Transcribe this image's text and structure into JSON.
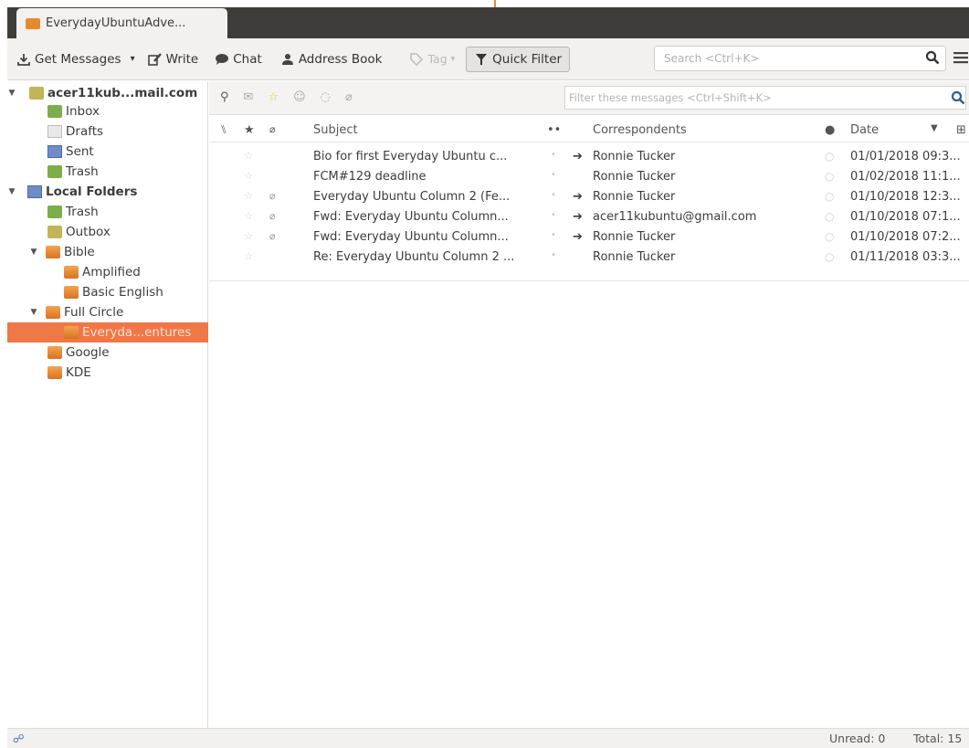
{
  "window": {
    "tab_title": "EverydayUbuntuAdve..."
  },
  "toolbar": {
    "get_messages": "Get Messages",
    "write": "Write",
    "chat": "Chat",
    "address_book": "Address Book",
    "tag": "Tag",
    "quick_filter": "Quick Filter",
    "search_placeholder": "Search <Ctrl+K>"
  },
  "folders": [
    {
      "label": "acer11kub...mail.com",
      "icon": "account-icon"
    },
    {
      "label": "Inbox",
      "icon": "inbox-icon"
    },
    {
      "label": "Drafts",
      "icon": "drafts-icon"
    },
    {
      "label": "Sent",
      "icon": "sent-icon"
    },
    {
      "label": "Trash",
      "icon": "trash-icon"
    },
    {
      "label": "Local Folders",
      "icon": "local-folders-icon"
    },
    {
      "label": "Trash",
      "icon": "trash-icon"
    },
    {
      "label": "Outbox",
      "icon": "outbox-icon"
    },
    {
      "label": "Bible",
      "icon": "folder-icon"
    },
    {
      "label": "Amplified",
      "icon": "folder-icon"
    },
    {
      "label": "Basic English",
      "icon": "folder-icon"
    },
    {
      "label": "Full Circle",
      "icon": "folder-icon"
    },
    {
      "label": "Everyda...entures",
      "icon": "folder-icon",
      "selected": true
    },
    {
      "label": "Google",
      "icon": "folder-icon"
    },
    {
      "label": "KDE",
      "icon": "folder-icon"
    }
  ],
  "quickfilter": {
    "filter_placeholder": "Filter these messages <Ctrl+Shift+K>"
  },
  "columns": {
    "subject": "Subject",
    "correspondents": "Correspondents",
    "date": "Date"
  },
  "messages": [
    {
      "subject": "Bio for first Everyday Ubuntu c...",
      "correspondent": "Ronnie Tucker",
      "replied": true,
      "attachment": false,
      "date": "01/01/2018 09:3..."
    },
    {
      "subject": "FCM#129 deadline",
      "correspondent": "Ronnie Tucker",
      "replied": false,
      "attachment": false,
      "date": "01/02/2018 11:1..."
    },
    {
      "subject": "Everyday Ubuntu Column 2 (Fe...",
      "correspondent": "Ronnie Tucker",
      "replied": true,
      "attachment": true,
      "date": "01/10/2018 12:3..."
    },
    {
      "subject": "Fwd: Everyday Ubuntu Column...",
      "correspondent": "acer11kubuntu@gmail.com",
      "replied": true,
      "attachment": true,
      "date": "01/10/2018 07:1..."
    },
    {
      "subject": "Fwd: Everyday Ubuntu Column...",
      "correspondent": "Ronnie Tucker",
      "replied": true,
      "attachment": true,
      "date": "01/10/2018 07:2..."
    },
    {
      "subject": "Re: Everyday Ubuntu Column 2 ...",
      "correspondent": "Ronnie Tucker",
      "replied": false,
      "attachment": false,
      "date": "01/11/2018 03:3..."
    }
  ],
  "status": {
    "unread": "Unread: 0",
    "total": "Total: 15"
  },
  "colors": {
    "selection": "#f07746",
    "folder": "#e58b2f",
    "titlebar": "#3e3d39"
  }
}
